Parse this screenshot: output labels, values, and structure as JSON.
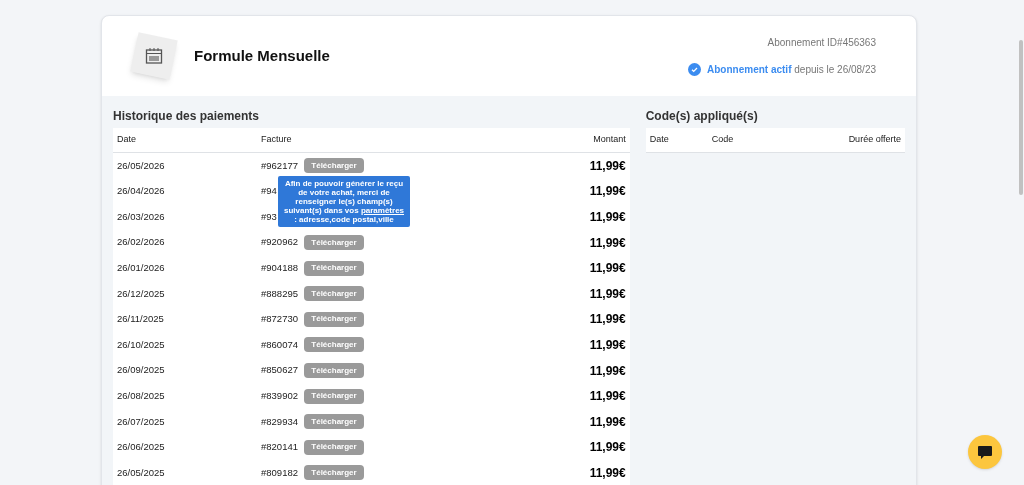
{
  "plan": {
    "title": "Formule Mensuelle",
    "subscription_id": "Abonnement ID#456363",
    "status_label": "Abonnement actif",
    "status_since": "depuis le 26/08/23",
    "active": true
  },
  "payments": {
    "title": "Historique des paiements",
    "columns": [
      "Date",
      "Facture",
      "Montant"
    ],
    "rows": [
      {
        "date": "26/05/2026",
        "invoice": "#962177",
        "download": "Télécharger",
        "amount": "11,99€"
      },
      {
        "date": "26/04/2026",
        "invoice": "#94",
        "amount": "11,99€"
      },
      {
        "date": "26/03/2026",
        "invoice": "#93",
        "amount": "11,99€"
      },
      {
        "date": "26/02/2026",
        "invoice": "#920962",
        "download": "Télécharger",
        "amount": "11,99€"
      },
      {
        "date": "26/01/2026",
        "invoice": "#904188",
        "download": "Télécharger",
        "amount": "11,99€"
      },
      {
        "date": "26/12/2025",
        "invoice": "#888295",
        "download": "Télécharger",
        "amount": "11,99€"
      },
      {
        "date": "26/11/2025",
        "invoice": "#872730",
        "download": "Télécharger",
        "amount": "11,99€"
      },
      {
        "date": "26/10/2025",
        "invoice": "#860074",
        "download": "Télécharger",
        "amount": "11,99€"
      },
      {
        "date": "26/09/2025",
        "invoice": "#850627",
        "download": "Télécharger",
        "amount": "11,99€"
      },
      {
        "date": "26/08/2025",
        "invoice": "#839902",
        "download": "Télécharger",
        "amount": "11,99€"
      },
      {
        "date": "26/07/2025",
        "invoice": "#829934",
        "download": "Télécharger",
        "amount": "11,99€"
      },
      {
        "date": "26/06/2025",
        "invoice": "#820141",
        "download": "Télécharger",
        "amount": "11,99€"
      },
      {
        "date": "26/05/2025",
        "invoice": "#809182",
        "download": "Télécharger",
        "amount": "11,99€"
      }
    ],
    "tooltip": {
      "before": "Afin de pouvoir générer le reçu de votre achat, merci de renseigner le(s) champ(s) suivant(s) dans vos",
      "link": "paramètres",
      "after": ": adresse,code postal,ville"
    }
  },
  "codes": {
    "title": "Code(s) appliqué(s)",
    "columns": [
      "Date",
      "Code",
      "Durée offerte"
    ]
  }
}
